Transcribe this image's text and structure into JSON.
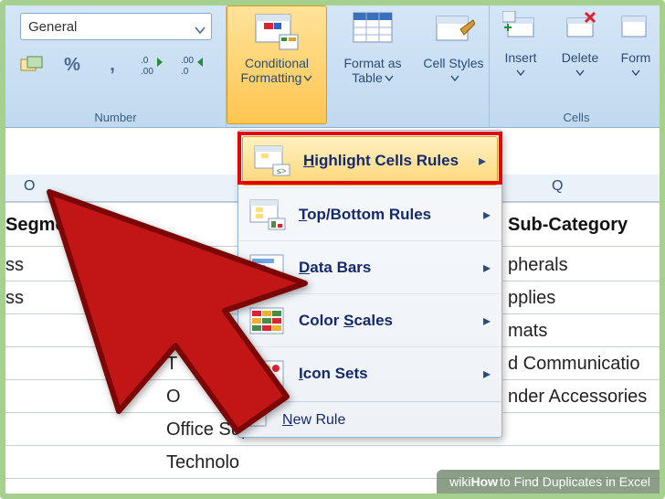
{
  "ribbon": {
    "number": {
      "group_label": "Number",
      "format_value": "General",
      "percent_symbol": "%",
      "thousands_symbol": ",",
      "inc_dec_label": ".0",
      "inc_dec_label2": ".00"
    },
    "conditional_formatting": {
      "label": "Conditional Formatting"
    },
    "format_table": {
      "label": "Format as Table"
    },
    "cell_styles": {
      "label": "Cell Styles"
    },
    "cells": {
      "group_label": "Cells",
      "insert": "Insert",
      "delete": "Delete",
      "format": "Form"
    }
  },
  "menu": {
    "highlight": "Highlight Cells Rules",
    "topbottom": "Top/Bottom Rules",
    "databars": "Data Bars",
    "colorscales": "Color Scales",
    "iconsets": "Icon Sets",
    "newrule": "New Rule"
  },
  "sheet": {
    "col_o": "O",
    "col_q": "Q",
    "hdr_segment": "Segment",
    "hdr_subcat": "Sub-Category",
    "rows_left": [
      "ss",
      "ss",
      "",
      "T",
      "O",
      "Office Sup",
      "Technolo"
    ],
    "rows_right": [
      "pherals",
      "pplies",
      "mats",
      "d Communicatio",
      "nder Accessories"
    ]
  },
  "watermark": {
    "brand": "wiki",
    "suffix": "How",
    "text": " to Find Duplicates in Excel"
  }
}
